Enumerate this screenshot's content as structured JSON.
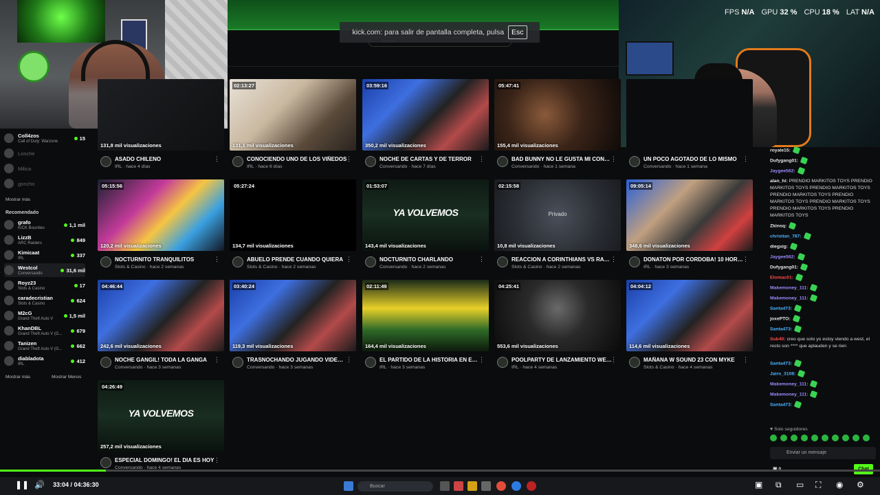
{
  "system_stats": {
    "fps_label": "FPS",
    "fps": "N/A",
    "gpu_label": "GPU",
    "gpu": "32 %",
    "cpu_label": "CPU",
    "cpu": "18 %",
    "lat_label": "LAT",
    "lat": "N/A"
  },
  "fullscreen_notice": {
    "text": "kick.com: para salir de pantalla completa, pulsa",
    "key": "Esc"
  },
  "page_search": {
    "placeholder": "Buscar"
  },
  "sidebar": {
    "following": [
      {
        "name": "Coll4zos",
        "category": "Call of Duty: Warzone",
        "viewers": "15",
        "online": true
      },
      {
        "name": "Lonche",
        "category": "",
        "viewers": "",
        "online": false
      },
      {
        "name": "Milica",
        "category": "",
        "viewers": "",
        "online": false
      },
      {
        "name": "goncho",
        "category": "",
        "viewers": "",
        "online": false
      }
    ],
    "show_more": "Mostrar más",
    "recommended_title": "Recomendado",
    "recommended": [
      {
        "name": "grafo",
        "category": "KICK Bounties",
        "viewers": "1,1 mil"
      },
      {
        "name": "LizzB",
        "category": "ARC Raiders",
        "viewers": "849"
      },
      {
        "name": "Kimicaat",
        "category": "IRL",
        "viewers": "337"
      },
      {
        "name": "Westcol",
        "category": "Conversando",
        "viewers": "31,6 mil"
      },
      {
        "name": "Royz23",
        "category": "Slots & Casino",
        "viewers": "17"
      },
      {
        "name": "caradecristian",
        "category": "Slots & Casino",
        "viewers": "624"
      },
      {
        "name": "M2cG",
        "category": "Grand Theft Auto V",
        "viewers": "1,5 mil"
      },
      {
        "name": "KhanDBL",
        "category": "Grand Theft Auto V (G...",
        "viewers": "679"
      },
      {
        "name": "Tanizen",
        "category": "Grand Theft Auto V (G...",
        "viewers": "662"
      },
      {
        "name": "diabladota",
        "category": "IRL",
        "viewers": "412"
      }
    ],
    "show_more_bottom": "Mostrar más",
    "show_less": "Mostrar Menos"
  },
  "videos": [
    {
      "duration": "",
      "views": "131,8 mil visualizaciones",
      "title": "ASADO CHILENO",
      "category": "IRL",
      "age": "hace 4 días",
      "thumb": "dark"
    },
    {
      "duration": "02:13:27",
      "views": "131,1 mil visualizaciones",
      "title": "CONOCIENDO UNO DE LOS VIÑEDOS",
      "category": "IRL",
      "age": "hace 6 días",
      "thumb": "dining"
    },
    {
      "duration": "03:59:16",
      "views": "350,2 mil visualizaciones",
      "title": "NOCHE DE CARTAS Y DE TERROR",
      "category": "Conversando",
      "age": "hace 7 días",
      "thumb": "studio"
    },
    {
      "duration": "05:47:41",
      "views": "155,4 mil visualizaciones",
      "title": "BAD BUNNY NO LE GUSTA MI CONTENIDO",
      "category": "Conversando",
      "age": "hace 1 semana",
      "thumb": "portrait"
    },
    {
      "duration": "",
      "views": "",
      "title": "UN POCO AGOTADO DE LO MISMO",
      "category": "Conversando",
      "age": "hace 1 semana",
      "thumb": "hidden"
    },
    {
      "duration": "05:15:56",
      "views": "120,2 mil visualizaciones",
      "title": "NOCTURNITO TRANQUILITOS",
      "category": "Slots & Casino",
      "age": "hace 2 semanas",
      "thumb": "slots"
    },
    {
      "duration": "05:27:24",
      "views": "134,7 mil visualizaciones",
      "title": "ABUELO PRENDE CUANDO QUIERA",
      "category": "Slots & Casino",
      "age": "hace 2 semanas",
      "thumb": "black"
    },
    {
      "duration": "01:53:07",
      "views": "143,4 mil visualizaciones",
      "title": "NOCTURNITO CHARLANDO",
      "category": "Conversando",
      "age": "hace 2 semanas",
      "thumb": "volvemos",
      "overlay": "YA VOLVEMOS"
    },
    {
      "duration": "02:15:58",
      "views": "10,8 mil visualizaciones",
      "title": "REACCION A CORINTHIANS VS RACING",
      "category": "Slots & Casino",
      "age": "hace 2 semanas",
      "thumb": "private",
      "overlay": "Privado"
    },
    {
      "duration": "09:05:14",
      "views": "348,6 mil visualizaciones",
      "title": "DONATON POR CORDOBA! 10 HORAS",
      "category": "IRL",
      "age": "hace 3 semanas",
      "thumb": "crowd"
    },
    {
      "duration": "04:46:44",
      "views": "242,6 mil visualizaciones",
      "title": "NOCHE GANGIL! TODA LA GANGA",
      "category": "Conversando",
      "age": "hace 3 semanas",
      "thumb": "studio"
    },
    {
      "duration": "03:40:24",
      "views": "119,3 mil visualizaciones",
      "title": "TRASNOCHANDO JUGANDO VIDEOJUEGOS",
      "category": "Conversando",
      "age": "hace 3 semanas",
      "thumb": "studio"
    },
    {
      "duration": "02:11:49",
      "views": "164,4 mil visualizaciones",
      "title": "EL PARTIDO DE LA HISTORIA EN EL ESTADIO",
      "category": "IRL",
      "age": "hace 3 semanas",
      "thumb": "stadium"
    },
    {
      "duration": "04:25:41",
      "views": "553,6 mil visualizaciones",
      "title": "POOLPARTY DE LANZAMIENTO WEST",
      "category": "IRL",
      "age": "hace 4 semanas",
      "thumb": "night"
    },
    {
      "duration": "04:04:12",
      "views": "114,6 mil visualizaciones",
      "title": "MAÑANA W SOUND 23 CON MYKE",
      "category": "Slots & Casino",
      "age": "hace 4 semanas",
      "thumb": "studio"
    },
    {
      "duration": "04:26:49",
      "views": "257,2 mil visualizaciones",
      "title": "ESPECIAL DOMINGO! EL DIA ES HOY",
      "category": "Conversando",
      "age": "hace 4 semanas",
      "thumb": "volvemos",
      "overlay": "YA VOLVEMOS"
    }
  ],
  "chat": {
    "messages": [
      {
        "user": "royale15:",
        "text": "",
        "color": "#e8e8e8",
        "emote": true
      },
      {
        "user": "Dufygang01:",
        "text": "",
        "color": "#e8e8e8",
        "emote": true
      },
      {
        "user": "Jaygee562:",
        "text": "",
        "color": "#9b8cff",
        "emote": true
      },
      {
        "user": "alan_hi:",
        "text": "PRENDIO MARKITOS TOYS PRENDIO MARKITOS TOYS PRENDIO MARKITOS TOYS PRENDIO MARKITOS TOYS PRENDIO MARKITOS TOYS PRENDIO MARKITOS TOYS PRENDIO MARKITOS TOYS PRENDIO MARKITOS TOYS",
        "color": "#e8e8e8",
        "emote": false
      },
      {
        "user": "Zkinsq:",
        "text": "",
        "color": "#e8e8e8",
        "emote": true
      },
      {
        "user": "christian_787:",
        "text": "",
        "color": "#4fb4ff",
        "emote": true
      },
      {
        "user": "diegxig:",
        "text": "",
        "color": "#e8e8e8",
        "emote": true
      },
      {
        "user": "Jaygee562:",
        "text": "",
        "color": "#9b8cff",
        "emote": true
      },
      {
        "user": "Dufygang01:",
        "text": "",
        "color": "#e8e8e8",
        "emote": true
      },
      {
        "user": "Elomac01:",
        "text": "",
        "color": "#ff4a4a",
        "emote": true
      },
      {
        "user": "Makemoney_111:",
        "text": "",
        "color": "#9b8cff",
        "emote": true
      },
      {
        "user": "Makemoney_111:",
        "text": "",
        "color": "#9b8cff",
        "emote": true
      },
      {
        "user": "Santa473:",
        "text": "",
        "color": "#4fb4ff",
        "emote": true
      },
      {
        "user": "joxePTO:",
        "text": "",
        "color": "#e8e8e8",
        "emote": true
      },
      {
        "user": "Santa473:",
        "text": "",
        "color": "#4fb4ff",
        "emote": true
      },
      {
        "user": "Sub40:",
        "text": "creo que solo yo estoy viendo a west, el resto son **** que aplauden y se rien",
        "color": "#ff4a4a",
        "emote": false
      },
      {
        "user": "Santa473:",
        "text": "",
        "color": "#4fb4ff",
        "emote": true
      },
      {
        "user": "Jairo_3108:",
        "text": "",
        "color": "#4fb4ff",
        "emote": true
      },
      {
        "user": "Makemoney_111:",
        "text": "",
        "color": "#9b8cff",
        "emote": true
      },
      {
        "user": "Makemoney_111:",
        "text": "",
        "color": "#9b8cff",
        "emote": true
      },
      {
        "user": "Santa473:",
        "text": "",
        "color": "#4fb4ff",
        "emote": true
      }
    ],
    "followers_only": "Solo seguidores",
    "input_placeholder": "Enviar un mensaje",
    "send_label": "Chat",
    "count": "0"
  },
  "player": {
    "current_time": "33:04",
    "duration": "04:36:30",
    "progress": 0.12
  },
  "taskbar": {
    "search_placeholder": "Buscar"
  },
  "accent": "#53fc18"
}
